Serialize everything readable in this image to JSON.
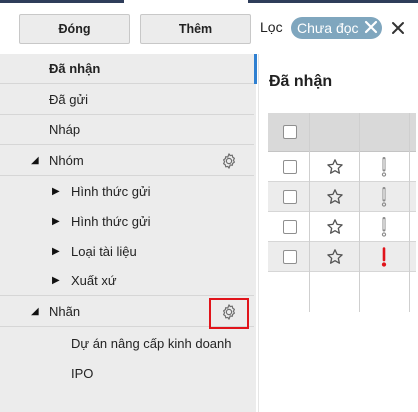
{
  "toolbar": {
    "close_label": "Đóng",
    "add_label": "Thêm",
    "filter_label": "Lọc",
    "filter_chip_label": "Chưa đọc"
  },
  "sidebar": {
    "inbox": "Đã nhận",
    "sent": "Đã gửi",
    "drafts": "Nháp",
    "groups": {
      "label": "Nhóm",
      "items": [
        "Hình thức gửi",
        "Hình thức gửi",
        "Loại tài liệu",
        "Xuất xứ"
      ]
    },
    "labels": {
      "label": "Nhãn",
      "items": [
        "Dự án nâng cấp kinh doanh",
        "IPO"
      ]
    }
  },
  "main": {
    "title": "Đã nhận",
    "rows": [
      {
        "important": false
      },
      {
        "important": false
      },
      {
        "important": false
      },
      {
        "important": true
      }
    ]
  },
  "colors": {
    "accent": "#2f80d1",
    "chip": "#7fa6be",
    "highlight_box": "#e1141b",
    "important": "#e1141b"
  }
}
